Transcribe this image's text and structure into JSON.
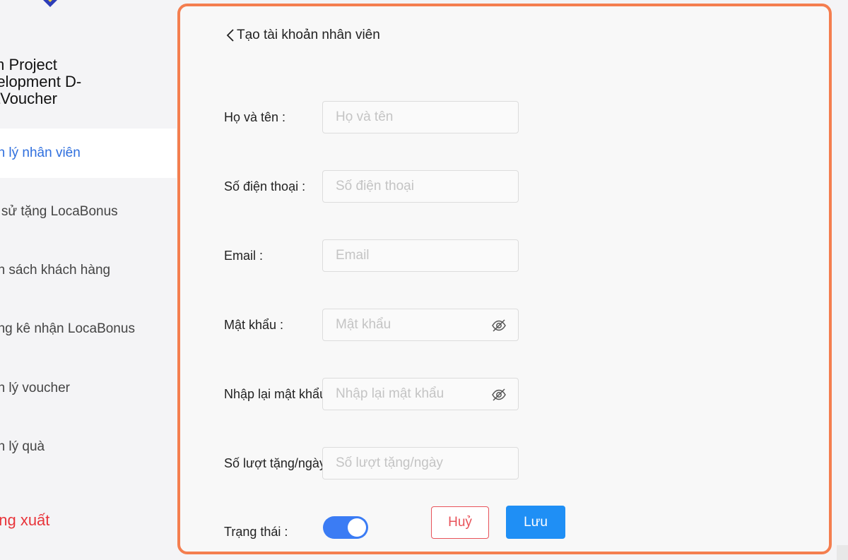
{
  "sidebar": {
    "project_title": "m Project\nrelopment D-\naVoucher",
    "items": [
      {
        "label": "ản lý nhân viên",
        "active": true
      },
      {
        "label": "h sử tặng LocaBonus",
        "active": false
      },
      {
        "label": "nh sách khách hàng",
        "active": false
      },
      {
        "label": "ống kê nhận LocaBonus",
        "active": false
      },
      {
        "label": "ản lý voucher",
        "active": false
      },
      {
        "label": "ản lý quà",
        "active": false
      }
    ],
    "logout_label": "ăng xuất"
  },
  "header": {
    "title": "Tạo tài khoản nhân viên"
  },
  "form": {
    "full_name": {
      "label": "Họ và tên :",
      "placeholder": "Họ và tên",
      "value": ""
    },
    "phone": {
      "label": "Số điện thoại :",
      "placeholder": "Số điện thoại",
      "value": ""
    },
    "email": {
      "label": "Email :",
      "placeholder": "Email",
      "value": ""
    },
    "password": {
      "label": "Mật khẩu :",
      "placeholder": "Mật khẩu",
      "value": ""
    },
    "confirm_password": {
      "label": "Nhập lại mật khẩu :",
      "placeholder": "Nhập lại mật khẩu",
      "value": ""
    },
    "daily_gift_limit": {
      "label": "Số lượt tặng/ngày :",
      "placeholder": "Số lượt tặng/ngày",
      "value": ""
    },
    "status": {
      "label": "Trạng thái :",
      "enabled": true
    }
  },
  "actions": {
    "cancel_label": "Huỷ",
    "save_label": "Lưu"
  },
  "colors": {
    "accent": "#f47e4f",
    "primary": "#1f8ff5",
    "danger": "#e8535a",
    "active_nav": "#2f6fde",
    "toggle_on": "#3b7cf4"
  },
  "icons": {
    "back": "chevron-left-icon",
    "password_visibility": "eye-off-icon"
  }
}
